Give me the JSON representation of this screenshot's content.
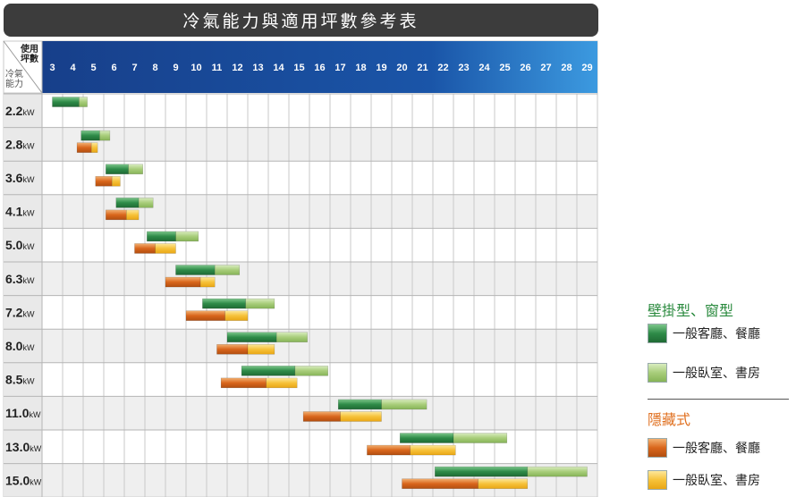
{
  "title": "冷氣能力與適用坪數參考表",
  "corner": {
    "top": "使用\n坪數",
    "bottom": "冷氣\n能力"
  },
  "legend": {
    "group1_title": "壁掛型、窗型",
    "group1_item1": "一般客廳、餐廳",
    "group1_item2": "一般臥室、書房",
    "group2_title": "隱藏式",
    "group2_item1": "一般客廳、餐廳",
    "group2_item2": "一般臥室、書房"
  },
  "colors": {
    "green_dark": "#2e8b48",
    "green_light": "#a8cd7a",
    "orange_dark": "#d9661c",
    "orange_light": "#f6c23a",
    "header_blue": "#1a55a8"
  },
  "chart_data": {
    "type": "bar",
    "title": "冷氣能力與適用坪數參考表",
    "xlabel": "使用坪數",
    "ylabel": "冷氣能力",
    "x_ticks": [
      3,
      4,
      5,
      6,
      7,
      8,
      9,
      10,
      11,
      12,
      13,
      14,
      15,
      16,
      17,
      18,
      19,
      20,
      21,
      22,
      23,
      24,
      25,
      26,
      27,
      28,
      29
    ],
    "categories": [
      "2.2",
      "2.8",
      "3.6",
      "4.1",
      "5.0",
      "6.3",
      "7.2",
      "8.0",
      "8.5",
      "11.0",
      "13.0",
      "15.0"
    ],
    "unit": "kW",
    "series": [
      {
        "name": "壁掛型、窗型 一般客廳、餐廳",
        "ranges": [
          [
            3.0,
            4.3
          ],
          [
            4.4,
            5.3
          ],
          [
            5.6,
            6.7
          ],
          [
            6.1,
            7.2
          ],
          [
            7.6,
            9.0
          ],
          [
            9.0,
            10.9
          ],
          [
            10.3,
            12.4
          ],
          [
            11.5,
            13.9
          ],
          [
            12.2,
            14.8
          ],
          [
            16.9,
            19.0
          ],
          [
            19.9,
            22.5
          ],
          [
            21.6,
            26.1
          ]
        ]
      },
      {
        "name": "壁掛型、窗型 一般臥室、書房",
        "ranges": [
          [
            4.3,
            4.7
          ],
          [
            5.3,
            5.8
          ],
          [
            6.7,
            7.4
          ],
          [
            7.2,
            7.9
          ],
          [
            9.0,
            10.1
          ],
          [
            10.9,
            12.1
          ],
          [
            12.4,
            13.8
          ],
          [
            13.9,
            15.4
          ],
          [
            14.8,
            16.4
          ],
          [
            19.0,
            21.2
          ],
          [
            22.5,
            25.1
          ],
          [
            26.1,
            29.0
          ]
        ]
      },
      {
        "name": "隱藏式 一般客廳、餐廳",
        "ranges": [
          null,
          [
            4.2,
            4.9
          ],
          [
            5.1,
            5.9
          ],
          [
            5.6,
            6.6
          ],
          [
            7.0,
            8.0
          ],
          [
            8.5,
            10.2
          ],
          [
            9.5,
            11.4
          ],
          [
            11.0,
            12.5
          ],
          [
            11.2,
            13.4
          ],
          [
            15.2,
            17.0
          ],
          [
            18.3,
            20.4
          ],
          [
            20.0,
            23.7
          ]
        ]
      },
      {
        "name": "隱藏式 一般臥室、書房",
        "ranges": [
          null,
          [
            4.9,
            5.2
          ],
          [
            5.9,
            6.3
          ],
          [
            6.6,
            7.2
          ],
          [
            8.0,
            9.0
          ],
          [
            10.2,
            10.9
          ],
          [
            11.4,
            12.5
          ],
          [
            12.5,
            13.8
          ],
          [
            13.4,
            14.9
          ],
          [
            17.0,
            19.0
          ],
          [
            20.4,
            22.6
          ],
          [
            23.7,
            26.1
          ]
        ]
      }
    ]
  }
}
